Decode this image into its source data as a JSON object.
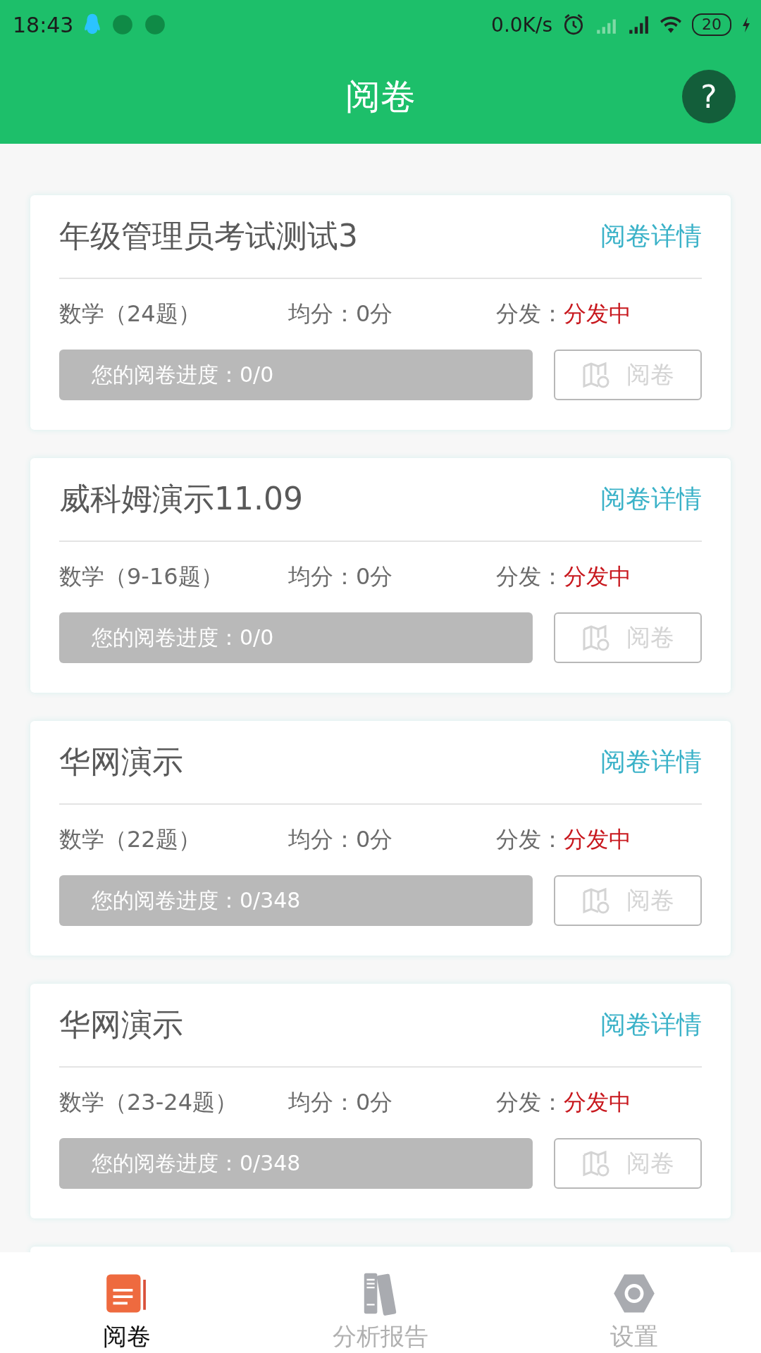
{
  "status_bar": {
    "time": "18:43",
    "net_speed": "0.0K/s",
    "battery": "20"
  },
  "header": {
    "title": "阅卷",
    "help": "?"
  },
  "cards": [
    {
      "title": "年级管理员考试测试3",
      "detail_link": "阅卷详情",
      "subject": "数学（24题）",
      "average": "均分：0分",
      "dispatch_label": "分发：",
      "dispatch_status": "分发中",
      "progress": {
        "text": "您的阅卷进度：0/0"
      },
      "action": {
        "label": "阅卷",
        "disabled": true
      }
    },
    {
      "title": "威科姆演示11.09",
      "detail_link": "阅卷详情",
      "subject": "数学（9-16题）",
      "average": "均分：0分",
      "dispatch_label": "分发：",
      "dispatch_status": "分发中",
      "progress": {
        "text": "您的阅卷进度：0/0"
      },
      "action": {
        "label": "阅卷",
        "disabled": true
      }
    },
    {
      "title": "华网演示",
      "detail_link": "阅卷详情",
      "subject": "数学（22题）",
      "average": "均分：0分",
      "dispatch_label": "分发：",
      "dispatch_status": "分发中",
      "progress": {
        "text": "您的阅卷进度：0/348"
      },
      "action": {
        "label": "阅卷",
        "disabled": true
      }
    },
    {
      "title": "华网演示",
      "detail_link": "阅卷详情",
      "subject": "数学（23-24题）",
      "average": "均分：0分",
      "dispatch_label": "分发：",
      "dispatch_status": "分发中",
      "progress": {
        "text": "您的阅卷进度：0/348"
      },
      "action": {
        "label": "阅卷",
        "disabled": true
      }
    }
  ],
  "bottom_nav": [
    {
      "kind": "grading",
      "label": "阅卷",
      "selected": true
    },
    {
      "kind": "report",
      "label": "分析报告",
      "selected": false
    },
    {
      "kind": "settings",
      "label": "设置",
      "selected": false
    }
  ]
}
